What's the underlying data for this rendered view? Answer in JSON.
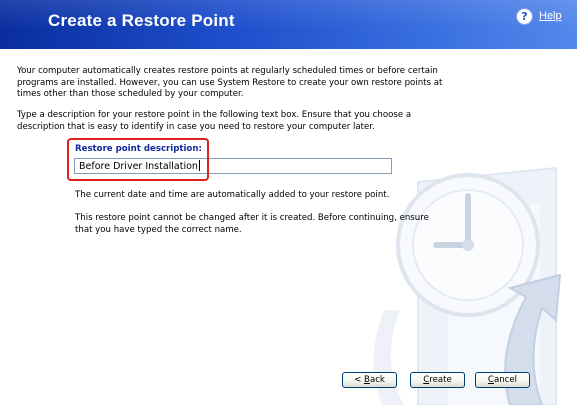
{
  "header": {
    "title": "Create a Restore Point",
    "help_label": "Help",
    "help_icon": "question-mark-icon",
    "help_glyph": "?"
  },
  "intro": {
    "paragraph1": "Your computer automatically creates restore points at regularly scheduled times or before certain programs are installed. However, you can use System Restore to create your own restore points at times other than those scheduled by your computer.",
    "paragraph2": "Type a description for your restore point in the following text box. Ensure that you choose a description that is easy to identify in case you need to restore your computer later."
  },
  "description_field": {
    "label": "Restore point description:",
    "value": "Before Driver Installation"
  },
  "notes": {
    "date_note": "The current date and time are automatically added to your restore point.",
    "warning": "This restore point cannot be changed after it is created. Before continuing, ensure that you have typed the correct name."
  },
  "buttons": {
    "back": {
      "prefix": "< ",
      "mnemonic": "B",
      "rest": "ack"
    },
    "create": {
      "prefix": "",
      "mnemonic": "C",
      "rest": "reate"
    },
    "cancel": {
      "prefix": "",
      "mnemonic": "C",
      "rest": "ancel"
    }
  },
  "colors": {
    "header_start": "#0a2ea0",
    "header_end": "#5488ec",
    "label_blue": "#102a9e",
    "highlight_red": "#e0201f"
  },
  "icons": {
    "watermark": "clock-restore-watermark-icon"
  }
}
